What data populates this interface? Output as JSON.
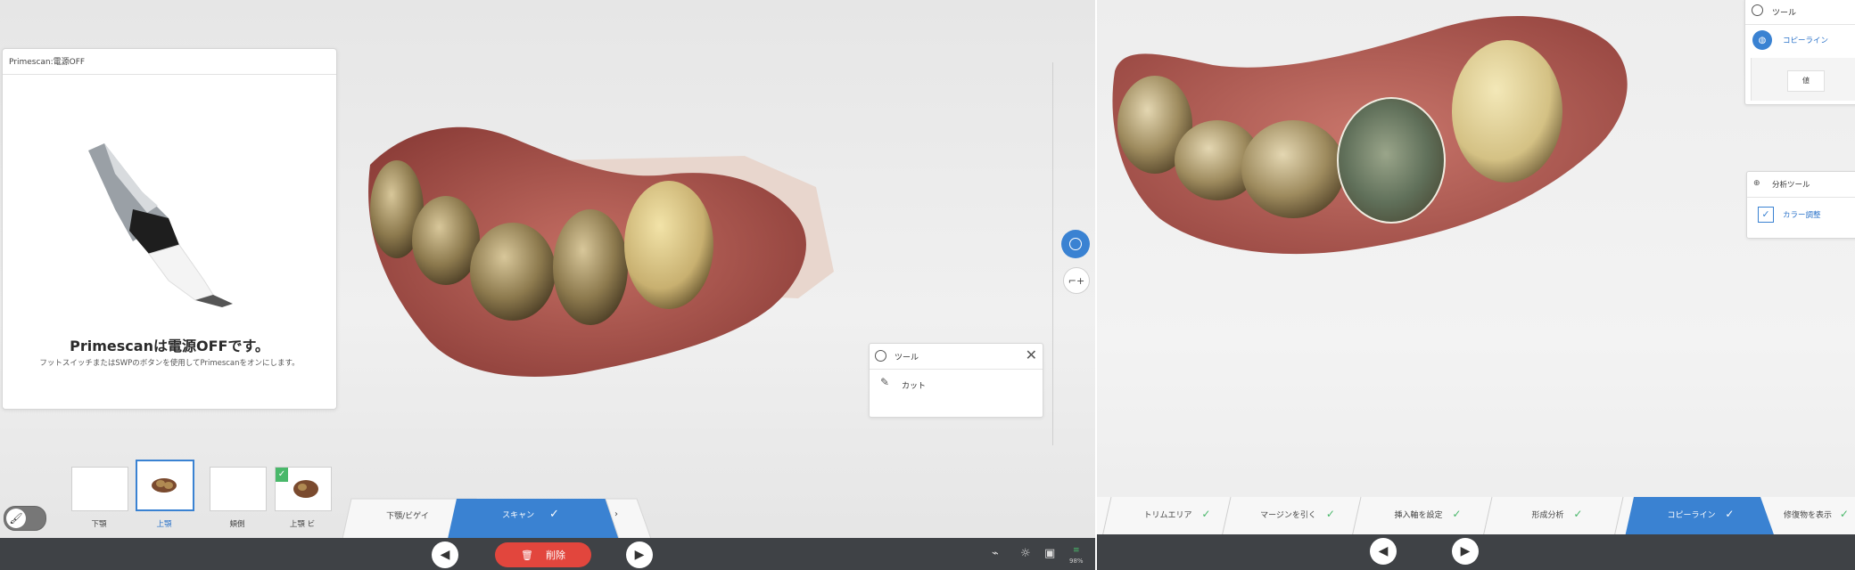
{
  "left_pane": {
    "dialog": {
      "title": "Primescan:電源OFF",
      "heading": "Primescanは電源OFFです。",
      "message": "フットスイッチまたはSWPのボタンを使用してPrimescanをオンにします。"
    },
    "tool_panel": {
      "title": "ツール",
      "item": "カット"
    },
    "thumbnails": [
      {
        "label": "下顎",
        "selected": false,
        "checked": false
      },
      {
        "label": "上顎",
        "selected": true,
        "checked": false
      },
      {
        "label": "頬側",
        "selected": false,
        "checked": false
      },
      {
        "label": "上顎 ビ",
        "selected": false,
        "checked": true
      }
    ],
    "steps": [
      {
        "label": "下顎/ビゲイ",
        "active": false
      },
      {
        "label": "スキャン",
        "active": true
      }
    ],
    "delete_label": "削除",
    "status_percent": "98%"
  },
  "right_pane": {
    "tools_panel": {
      "title": "ツール",
      "item": "コピーライン",
      "sub_item": "値"
    },
    "analysis_panel": {
      "title": "分析ツール",
      "item": "カラー調整"
    },
    "steps": [
      {
        "label": "トリムエリア",
        "active": false
      },
      {
        "label": "マージンを引く",
        "active": false
      },
      {
        "label": "挿入軸を設定",
        "active": false
      },
      {
        "label": "形成分析",
        "active": false
      },
      {
        "label": "コピーライン",
        "active": true
      },
      {
        "label": "修復物を表示",
        "active": false
      }
    ]
  },
  "colors": {
    "accent_blue": "#3a82d2",
    "delete_red": "#e2463d",
    "check_green": "#49b86a",
    "dark_bar": "#3f4246"
  }
}
